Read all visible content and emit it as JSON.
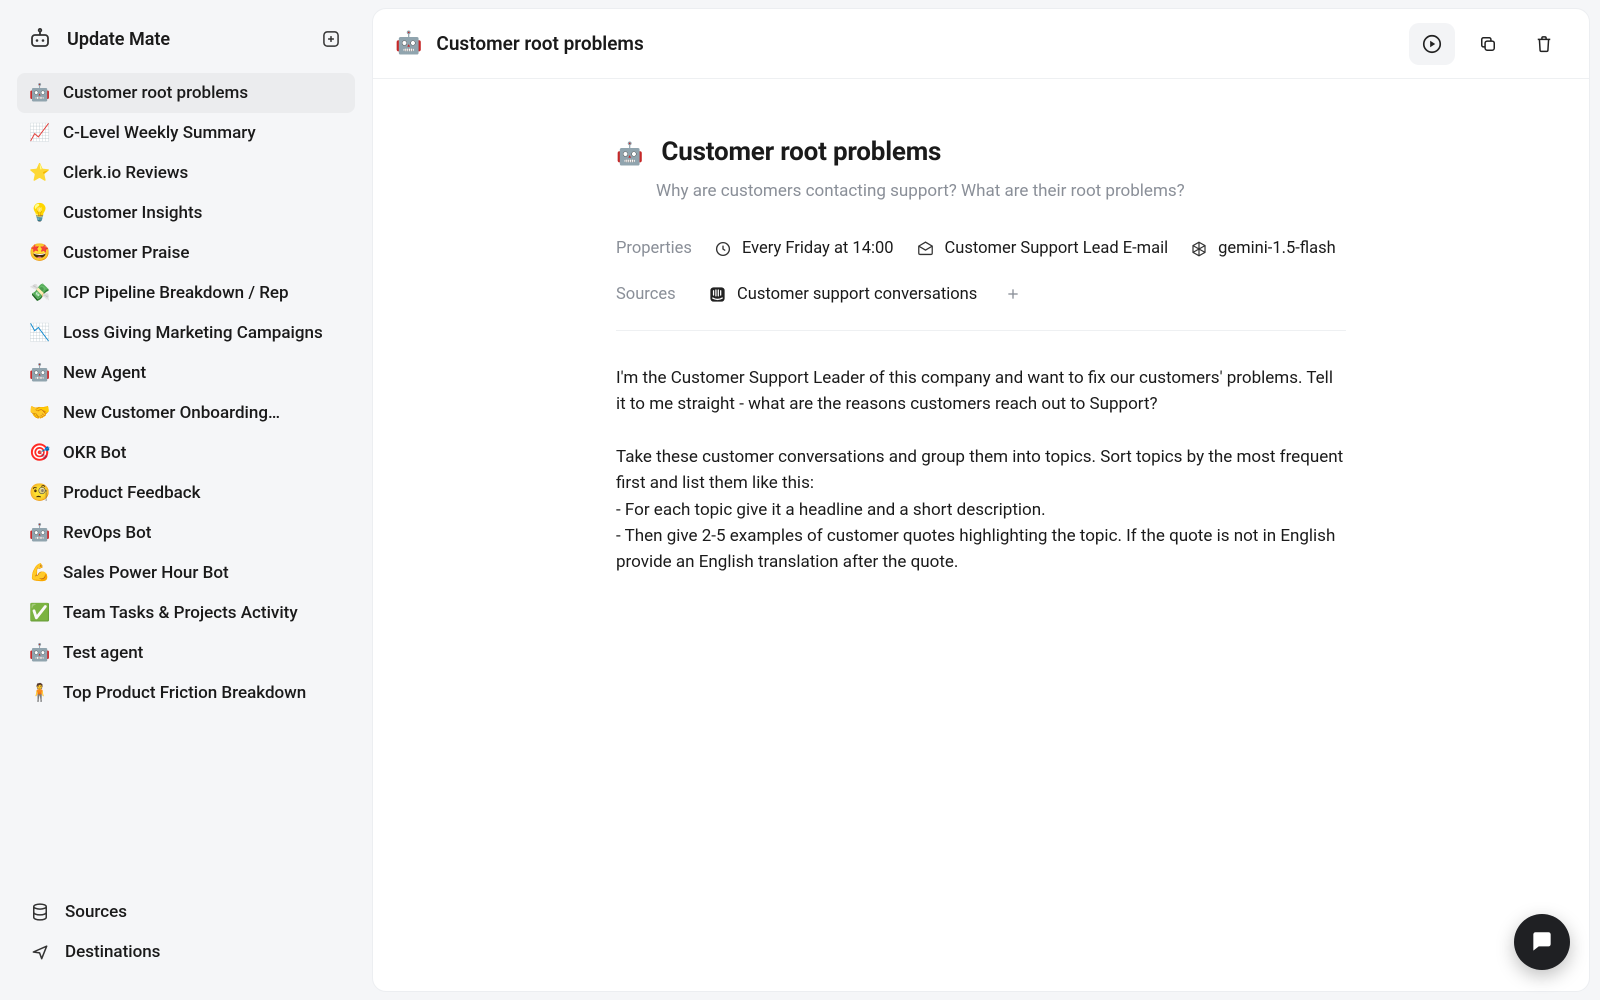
{
  "sidebar": {
    "app_title": "Update Mate",
    "footer": {
      "sources": "Sources",
      "destinations": "Destinations"
    },
    "agents": [
      {
        "emoji": "🤖",
        "label": "Customer root problems",
        "active": true
      },
      {
        "emoji": "📈",
        "label": "C-Level Weekly Summary"
      },
      {
        "emoji": "⭐",
        "label": "Clerk.io Reviews"
      },
      {
        "emoji": "💡",
        "label": "Customer Insights"
      },
      {
        "emoji": "🤩",
        "label": "Customer Praise"
      },
      {
        "emoji": "💸",
        "label": "ICP Pipeline Breakdown / Rep"
      },
      {
        "emoji": "📉",
        "label": "Loss Giving Marketing Campaigns"
      },
      {
        "emoji": "🤖",
        "label": "New Agent"
      },
      {
        "emoji": "🤝",
        "label": "New Customer Onboarding…"
      },
      {
        "emoji": "🎯",
        "label": "OKR Bot"
      },
      {
        "emoji": "🧐",
        "label": "Product Feedback"
      },
      {
        "emoji": "🤖",
        "label": "RevOps Bot"
      },
      {
        "emoji": "💪",
        "label": "Sales Power Hour Bot"
      },
      {
        "emoji": "✅",
        "label": "Team Tasks & Projects Activity"
      },
      {
        "emoji": "🤖",
        "label": "Test agent"
      },
      {
        "emoji": "🧍",
        "label": "Top Product Friction Breakdown"
      }
    ]
  },
  "doc": {
    "emoji": "🤖",
    "title": "Customer root problems",
    "subtitle": "Why are customers contacting support? What are their root problems?",
    "properties_label": "Properties",
    "schedule": "Every Friday at 14:00",
    "destination": "Customer Support Lead E-mail",
    "model": "gemini-1.5-flash",
    "sources_label": "Sources",
    "source_1": "Customer support conversations",
    "body": "I'm the Customer Support Leader of this company and want to fix our customers' problems. Tell it to me straight - what are the reasons customers reach out to Support?\n\nTake these customer conversations and group them into topics. Sort topics by the most frequent first and list them like this:\n- For each topic give it a headline and a short description.\n- Then give 2-5 examples of customer quotes highlighting the topic. If the quote is not in English provide an English translation after the quote."
  }
}
